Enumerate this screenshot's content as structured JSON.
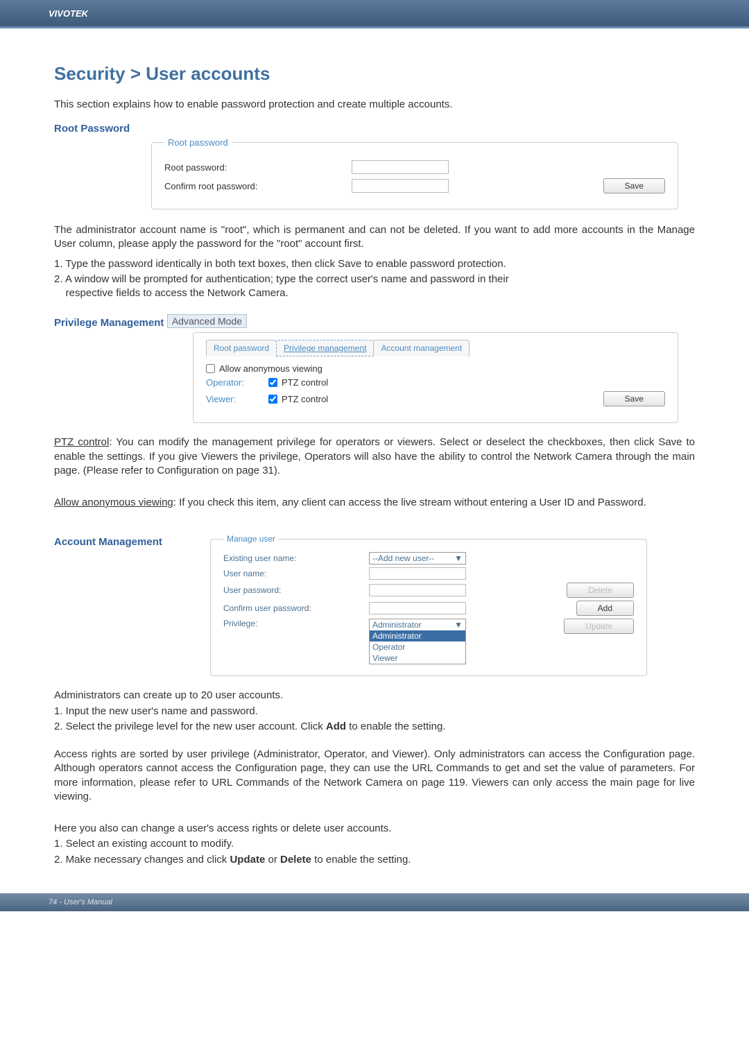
{
  "header": {
    "brand": "VIVOTEK"
  },
  "title": "Security > User accounts",
  "intro": "This section explains how to enable password protection and create multiple accounts.",
  "rootpw": {
    "heading": "Root Password",
    "legend": "Root password",
    "label1": "Root password:",
    "label2": "Confirm root password:",
    "save": "Save"
  },
  "para1": "The administrator account name is \"root\", which is permanent and can not be deleted. If you want to add more accounts in the Manage User column, please apply the password for the \"root\" account first.",
  "steps1": [
    "1. Type the password identically in both text boxes, then click Save to enable password protection.",
    "2. A window will be prompted for authentication; type the correct user's name and password in their respective fields to access the Network Camera."
  ],
  "priv": {
    "heading": "Privilege Management",
    "badge": "Advanced Mode",
    "tabs": [
      "Root password",
      "Privilege management",
      "Account management"
    ],
    "allow": "Allow anonymous viewing",
    "operator": "Operator:",
    "viewer": "Viewer:",
    "ptz": "PTZ control",
    "save": "Save"
  },
  "para2a": "PTZ control",
  "para2b": ": You can modify the management privilege for operators or viewers. Select or deselect the checkboxes, then click Save to enable the settings. If you give Viewers the privilege, Operators will also have the ability to control the Network Camera through the main page. (Please refer to Configuration on page 31).",
  "para3a": "Allow anonymous viewing",
  "para3b": ": If you check this item, any client can access the live stream without entering a User ID and Password.",
  "acct": {
    "heading": "Account Management",
    "legend": "Manage user",
    "existing": "Existing user name:",
    "existing_val": "--Add new user--",
    "uname": "User name:",
    "upass": "User password:",
    "cpass": "Confirm user password:",
    "privilege": "Privilege:",
    "opts": [
      "Administrator",
      "Administrator",
      "Operator",
      "Viewer"
    ],
    "delete": "Delete",
    "add": "Add",
    "update": "Update"
  },
  "para4": "Administrators can create up to 20 user accounts.",
  "steps2": [
    "1. Input the new user's name and password.",
    "2. Select the privilege level for the new user account. Click Add to enable the setting."
  ],
  "para5": "Access rights are sorted by user privilege (Administrator, Operator, and Viewer). Only administrators can access the Configuration page. Although operators cannot access the Configuration page, they can use the URL Commands to get and set the value of parameters. For more information, please refer to URL Commands of the Network Camera on page 119. Viewers can only access the main page for live viewing.",
  "para6": "Here you also can change a user's access rights or delete user accounts.",
  "steps3": [
    "1. Select an existing account to modify.",
    "2. Make necessary changes and click Update or Delete to enable the setting."
  ],
  "footer": "74 - User's Manual"
}
